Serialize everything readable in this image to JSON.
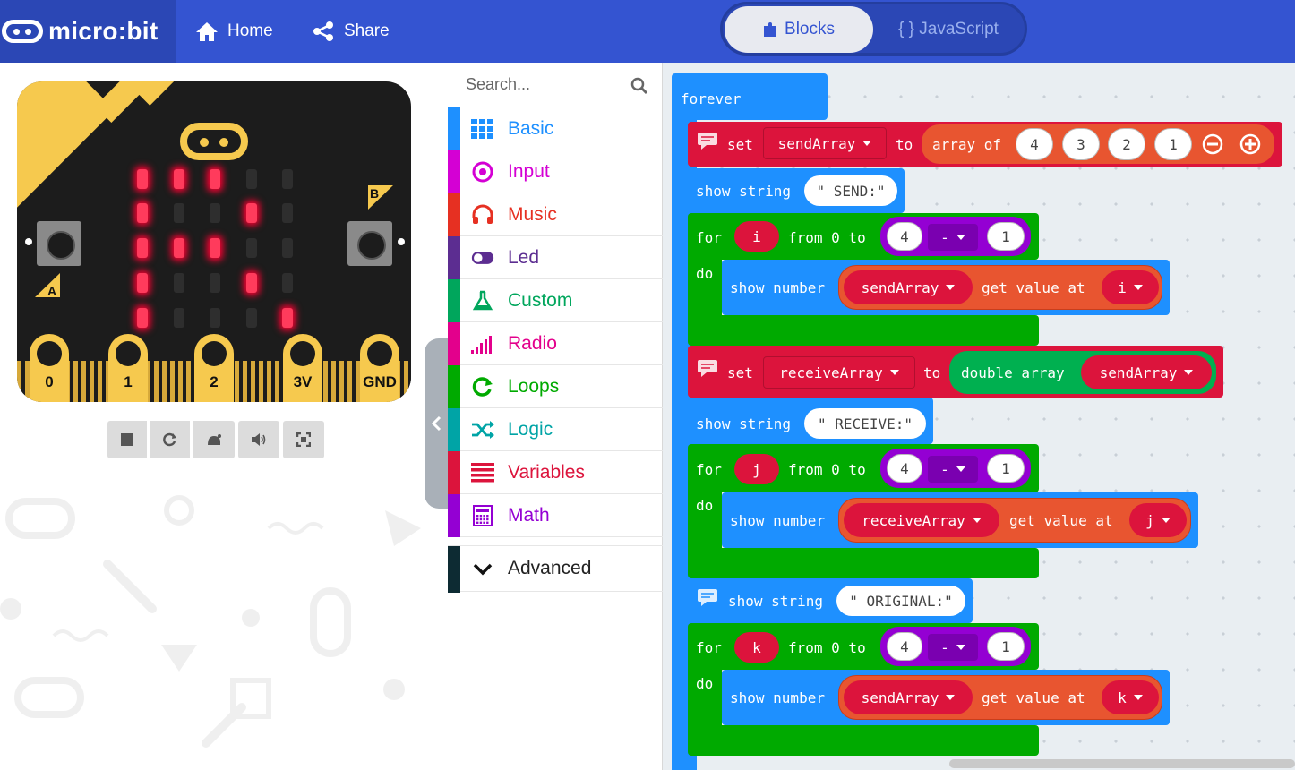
{
  "app": {
    "logo_text": "micro:bit",
    "nav": {
      "home": "Home",
      "share": "Share"
    },
    "editor_toggle": {
      "blocks": "Blocks",
      "javascript": "{ } JavaScript",
      "active": "Blocks"
    }
  },
  "simulator": {
    "leds_on": [
      [
        1,
        1,
        1,
        0,
        0
      ],
      [
        1,
        0,
        0,
        1,
        0
      ],
      [
        1,
        1,
        1,
        0,
        0
      ],
      [
        1,
        0,
        0,
        1,
        0
      ],
      [
        1,
        0,
        0,
        0,
        1
      ]
    ],
    "buttons": {
      "a": "A",
      "b": "B"
    },
    "pins": [
      "0",
      "1",
      "2",
      "3V",
      "GND"
    ],
    "controls": [
      "stop-icon",
      "restart-icon",
      "slowmo-icon",
      "sound-icon",
      "fullscreen-icon"
    ]
  },
  "toolbox": {
    "search_placeholder": "Search...",
    "categories": [
      {
        "label": "Basic",
        "color": "#1e90ff",
        "icon": "grid-icon"
      },
      {
        "label": "Input",
        "color": "#d400d4",
        "icon": "target-icon"
      },
      {
        "label": "Music",
        "color": "#e63022",
        "icon": "headphones-icon"
      },
      {
        "label": "Led",
        "color": "#5c2d91",
        "icon": "toggle-icon"
      },
      {
        "label": "Custom",
        "color": "#00a65c",
        "icon": "flask-icon"
      },
      {
        "label": "Radio",
        "color": "#e3008c",
        "icon": "signal-icon"
      },
      {
        "label": "Loops",
        "color": "#00aa00",
        "icon": "refresh-icon"
      },
      {
        "label": "Logic",
        "color": "#00a4a6",
        "icon": "shuffle-icon"
      },
      {
        "label": "Variables",
        "color": "#dc143c",
        "icon": "list-icon"
      },
      {
        "label": "Math",
        "color": "#9400d3",
        "icon": "calculator-icon"
      }
    ],
    "advanced": {
      "label": "Advanced",
      "color": "#0d2b33"
    }
  },
  "blocks": {
    "forever": "forever",
    "set_kw": "set",
    "to_kw": "to",
    "array_of": "array of",
    "array_values": [
      "4",
      "3",
      "2",
      "1"
    ],
    "show_string": "show string",
    "show_number": "show number",
    "for_kw": "for",
    "from_kw": "from 0 to",
    "do_kw": "do",
    "get_value_at": "get value at",
    "minus_op": "-",
    "loop_upper": "4",
    "loop_sub": "1",
    "double_array": "double array",
    "var_send": "sendArray",
    "var_receive": "receiveArray",
    "var_i": "i",
    "var_j": "j",
    "var_k": "k",
    "str_send": "\" SEND:\"",
    "str_receive": "\" RECEIVE:\"",
    "str_original": "\" ORIGINAL:\""
  }
}
